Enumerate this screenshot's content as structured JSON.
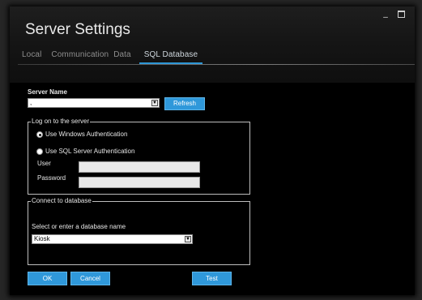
{
  "window": {
    "title": "Server Settings",
    "minimize_glyph": "_",
    "maximize_glyph": ""
  },
  "tabs": [
    {
      "label": "Local",
      "active": false
    },
    {
      "label": "Communication",
      "active": false
    },
    {
      "label": "Data",
      "active": false
    },
    {
      "label": "SQL Database",
      "active": true
    }
  ],
  "server": {
    "label": "Server Name",
    "value": ",",
    "refresh_label": "Refresh"
  },
  "logon": {
    "legend": "Log on to the server",
    "options": [
      {
        "label": "Use Windows Authentication",
        "checked": true
      },
      {
        "label": "Use SQL Server Authentication",
        "checked": false
      }
    ],
    "user_label": "User",
    "user_value": "",
    "password_label": "Password",
    "password_value": ""
  },
  "database": {
    "legend": "Connect to database",
    "prompt": "Select or enter a database name",
    "value": "Kiosk"
  },
  "buttons": {
    "ok": "OK",
    "cancel": "Cancel",
    "test": "Test"
  },
  "colors": {
    "accent": "#2f98da",
    "background": "#000000"
  }
}
